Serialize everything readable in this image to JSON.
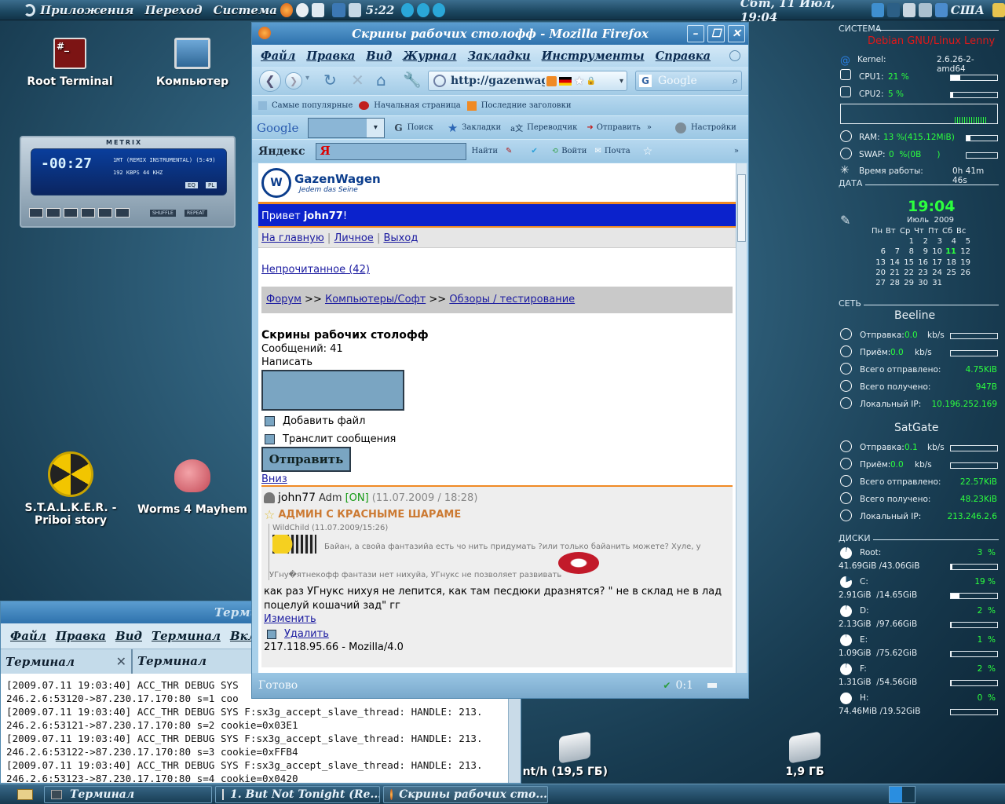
{
  "top_panel": {
    "menus": [
      "Приложения",
      "Переход",
      "Система"
    ],
    "time_left": "5:22",
    "datetime": "Сбт, 11 Июл, 19:04",
    "layout": "США"
  },
  "desktop_icons": [
    {
      "label": "Root Terminal"
    },
    {
      "label": "Компьютер"
    },
    {
      "label": "S.T.A.L.K.E.R. - Priboi story"
    },
    {
      "label": "Worms 4 Mayhem"
    },
    {
      "label": "nt/h (19,5 ГБ)"
    },
    {
      "label": "1,9 ГБ"
    }
  ],
  "player": {
    "brand": "METRIX",
    "time": "-00:27",
    "track": "1MT (REMIX INSTRUMENTAL) (5:49)",
    "kbps": "192",
    "khz": "44",
    "eq": "EQ",
    "pl": "PL",
    "shuffle": "SHUFFLE",
    "repeat": "REPEAT"
  },
  "firefox": {
    "title": "Скрины рабочих столофф - Mozilla Firefox",
    "menu": [
      "Файл",
      "Правка",
      "Вид",
      "Журнал",
      "Закладки",
      "Инструменты",
      "Справка"
    ],
    "url": "http://gazenwager",
    "search_placeholder": "Google",
    "bookmarks": [
      "Самые популярные",
      "Начальная страница",
      "Последние заголовки"
    ],
    "google_bar": {
      "logo": "Google",
      "search": "Поиск",
      "bookmarks": "Закладки",
      "translate": "Переводчик",
      "send": "Отправить",
      "more": "»",
      "settings": "Настройки"
    },
    "yandex_bar": {
      "logo": "Яндекс",
      "find": "Найти",
      "login": "Войти",
      "mail": "Почта",
      "more": "»"
    },
    "status": "Готово",
    "status_count": "0:1"
  },
  "page": {
    "logo": "GazenWagen",
    "slogan": "Jedem das Seine",
    "greeting": "Привет ",
    "user": "john77",
    "greeting_end": "!",
    "nav": [
      "На главную",
      "Личное",
      "Выход"
    ],
    "unread": "Непрочитанное (42)",
    "breadcrumb": [
      "Форум",
      "Компьютеры/Софт",
      "Обзоры / тестирование"
    ],
    "breadcrumb_sep": ">>",
    "topic_title": "Скрины рабочих столофф",
    "messages": "Сообщений: 41",
    "write": "Написать",
    "add_file": "Добавить файл",
    "translit": "Транслит сообщения",
    "send": "Отправить",
    "down": "Вниз",
    "post": {
      "author": "john77",
      "role": "Adm",
      "online": "[ON]",
      "date": "(11.07.2009 / 18:28)",
      "status": "АДМИН С КРАСНЫМЕ ШАРАМЕ",
      "quote_head": "WildChild (11.07.2009/15:26)",
      "quote_body": "Байан, а свойа фантазийа есть чо нить придумать ?или только байанить можете? Хуле, у",
      "quote_tail": "УГну�ятнекофф фантази нет нихуйа, УГнукс не позволяет развивать",
      "text": "как раз УГнукс нихуя не лепится, как там песдюки дразнятся? \" не в склад не в лад поцелуй кошачий зад\" гг",
      "edit": "Изменить",
      "delete": "Удалить",
      "ip": "217.118.95.66 - Mozilla/4.0"
    }
  },
  "terminal": {
    "title": "Терми",
    "menu": [
      "Файл",
      "Правка",
      "Вид",
      "Терминал",
      "Вкладк"
    ],
    "tabs": [
      "Терминал",
      "Терминал"
    ],
    "lines": [
      "[2009.07.11 19:03:40] ACC_THR DEBUG SYS",
      "246.2.6:53120->87.230.17.170:80 s=1 coo",
      "[2009.07.11 19:03:40] ACC_THR DEBUG SYS F:sx3g_accept_slave_thread: HANDLE: 213.",
      "246.2.6:53121->87.230.17.170:80 s=2 cookie=0x03E1",
      "[2009.07.11 19:03:40] ACC_THR DEBUG SYS F:sx3g_accept_slave_thread: HANDLE: 213.",
      "246.2.6:53122->87.230.17.170:80 s=3 cookie=0xFFB4",
      "[2009.07.11 19:03:40] ACC_THR DEBUG SYS F:sx3g_accept_slave_thread: HANDLE: 213.",
      "246.2.6:53123->87.230.17.170:80 s=4 cookie=0x0420"
    ]
  },
  "conky": {
    "system_title": "СИСТЕМА",
    "distro": "Debian GNU/Linux Lenny",
    "kernel_label": "Kernel:",
    "kernel": "2.6.26-2-amd64",
    "cpu1_label": "CPU1:",
    "cpu1": "21 %",
    "cpu1_pct": 21,
    "cpu2_label": "CPU2:",
    "cpu2": "5  %",
    "cpu2_pct": 5,
    "ram_label": "RAM:",
    "ram": "13 %(415.12MiB)",
    "ram_pct": 13,
    "swap_label": "SWAP:",
    "swap": "0  %(0B      )",
    "swap_pct": 0,
    "uptime_label": "Время работы:",
    "uptime": "0h 41m 46s",
    "date_title": "ДАТА",
    "clock": "19:04",
    "month": "Июль  2009",
    "weekdays": [
      "Пн",
      "Вт",
      "Ср",
      "Чт",
      "Пт",
      "Сб",
      "Вс"
    ],
    "calendar": [
      [
        "",
        "",
        "1",
        "2",
        "3",
        "4",
        "5"
      ],
      [
        "6",
        "7",
        "8",
        "9",
        "10",
        "11",
        "12"
      ],
      [
        "13",
        "14",
        "15",
        "16",
        "17",
        "18",
        "19"
      ],
      [
        "20",
        "21",
        "22",
        "23",
        "24",
        "25",
        "26"
      ],
      [
        "27",
        "28",
        "29",
        "30",
        "31",
        "",
        ""
      ]
    ],
    "today": "11",
    "net_title": "СЕТЬ",
    "nets": [
      {
        "name": "Beeline",
        "up_label": "Отправка:",
        "up": "0.0",
        "down_label": "Приём:",
        "down": "0.0",
        "unit": "kb/s",
        "sent_label": "Всего отправлено:",
        "sent": "4.75KiB",
        "recv_label": "Всего получено:",
        "recv": "947B",
        "ip_label": "Локальный IP:",
        "ip": "10.196.252.169"
      },
      {
        "name": "SatGate",
        "up_label": "Отправка:",
        "up": "0.1",
        "down_label": "Приём:",
        "down": "0.0",
        "unit": "kb/s",
        "sent_label": "Всего отправлено:",
        "sent": "22.57KiB",
        "recv_label": "Всего получено:",
        "recv": "48.23KiB",
        "ip_label": "Локальный IP:",
        "ip": "213.246.2.6"
      }
    ],
    "disks_title": "ДИСКИ",
    "disks": [
      {
        "name": "Root:",
        "pct": "3  %",
        "value": 3,
        "size": "41.69GiB /43.06GiB"
      },
      {
        "name": "C:",
        "pct": "19 %",
        "value": 19,
        "size": "2.91GiB  /14.65GiB"
      },
      {
        "name": "D:",
        "pct": "2  %",
        "value": 2,
        "size": "2.13GiB  /97.66GiB"
      },
      {
        "name": "E:",
        "pct": "1  %",
        "value": 1,
        "size": "1.09GiB  /75.62GiB"
      },
      {
        "name": "F:",
        "pct": "2  %",
        "value": 2,
        "size": "1.31GiB  /54.56GiB"
      },
      {
        "name": "H:",
        "pct": "0  %",
        "value": 0,
        "size": "74.46MiB /19.52GiB"
      }
    ]
  },
  "taskbar": {
    "items": [
      "Терминал",
      "1. But Not Tonight (Re...",
      "Скрины рабочих сто..."
    ]
  }
}
